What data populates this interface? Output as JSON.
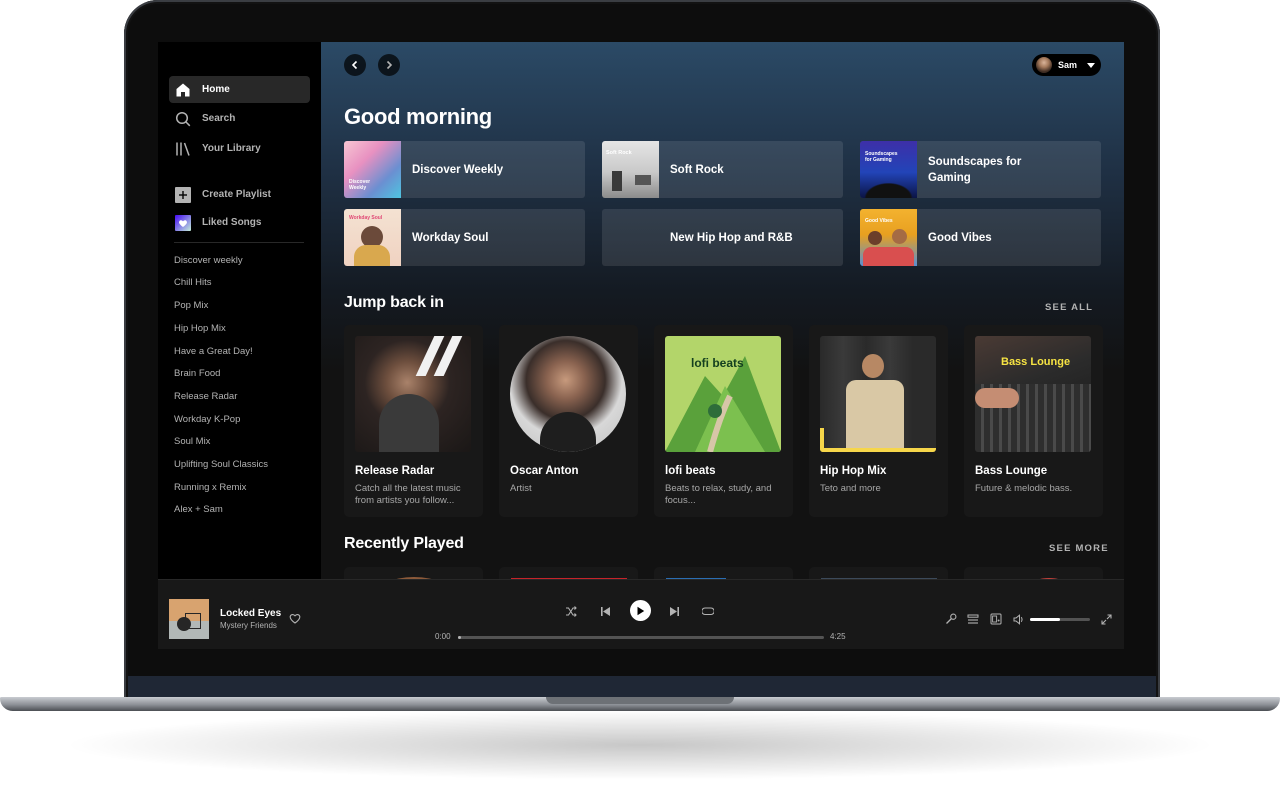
{
  "sidebar": {
    "nav": [
      {
        "label": "Home",
        "icon": "home-icon"
      },
      {
        "label": "Search",
        "icon": "search-icon"
      },
      {
        "label": "Your Library",
        "icon": "library-icon"
      }
    ],
    "actions": [
      {
        "label": "Create Playlist",
        "icon": "plus-icon"
      },
      {
        "label": "Liked Songs",
        "icon": "heart-icon"
      }
    ],
    "playlists": [
      "Discover weekly",
      "Chill Hits",
      "Pop Mix",
      "Hip Hop Mix",
      "Have a Great Day!",
      "Brain Food",
      "Release Radar",
      "Workday K-Pop",
      "Soul Mix",
      "Uplifting Soul Classics",
      "Running x Remix",
      "Alex + Sam"
    ]
  },
  "header": {
    "user": "Sam"
  },
  "main": {
    "greeting": "Good morning",
    "quick_picks": [
      {
        "title": "Discover Weekly",
        "cover_text": "Discover Weekly"
      },
      {
        "title": "Soft Rock",
        "cover_text": "Soft Rock"
      },
      {
        "title": "Soundscapes for Gaming",
        "cover_text": "Soundscapes for Gaming"
      },
      {
        "title": "Workday Soul",
        "cover_text": "Workday Soul"
      },
      {
        "title": "New Hip Hop and R&B",
        "cover_text": ""
      },
      {
        "title": "Good Vibes",
        "cover_text": "Good Vibes"
      }
    ],
    "jump_back": {
      "title": "Jump back in",
      "see_all": "SEE ALL",
      "cards": [
        {
          "title": "Release Radar",
          "subtitle": "Catch all the latest music from artists you follow..."
        },
        {
          "title": "Oscar Anton",
          "subtitle": "Artist"
        },
        {
          "title": "lofi beats",
          "subtitle": "Beats to relax, study, and focus...",
          "cover_text": "lofi beats"
        },
        {
          "title": "Hip Hop Mix",
          "subtitle": "Teto and more"
        },
        {
          "title": "Bass Lounge",
          "subtitle": "Future & melodic bass.",
          "cover_text": "Bass Lounge"
        }
      ]
    },
    "recently_played": {
      "title": "Recently Played",
      "see_more": "SEE MORE"
    }
  },
  "player": {
    "track": "Locked Eyes",
    "artist": "Mystery Friends",
    "elapsed": "0:00",
    "duration": "4:25",
    "progress": 0.0,
    "volume": 0.5
  },
  "colors": {
    "accent": "#1db954",
    "background": "#121212",
    "sidebar": "#000000"
  }
}
